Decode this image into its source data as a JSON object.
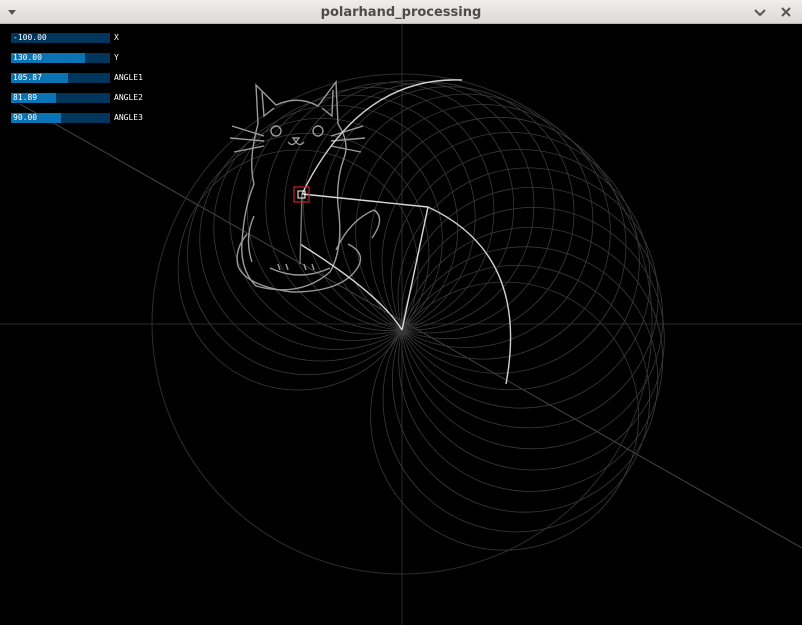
{
  "window": {
    "title": "polarhand_processing"
  },
  "sliders": [
    {
      "label": "X",
      "value": "-100.00",
      "level": 0.0
    },
    {
      "label": "Y",
      "value": "130.00",
      "level": 0.75
    },
    {
      "label": "ANGLE1",
      "value": "105.87",
      "level": 0.58
    },
    {
      "label": "ANGLE2",
      "value": "81.89",
      "level": 0.45
    },
    {
      "label": "ANGLE3",
      "value": "90.00",
      "level": 0.5
    }
  ],
  "colors": {
    "slider_bg": "#00355c",
    "slider_fill": "#0a73b3",
    "handle": "#cc2222"
  }
}
